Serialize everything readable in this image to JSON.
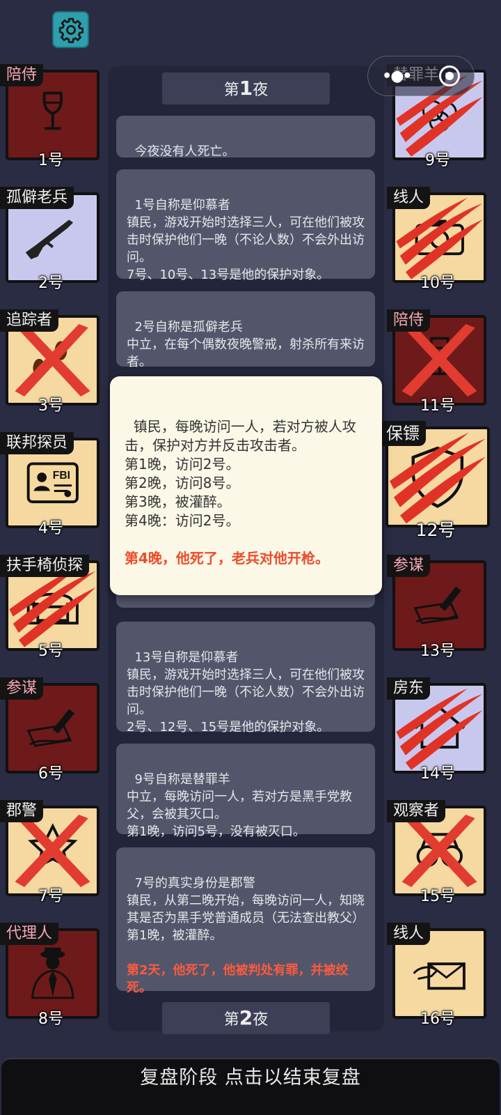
{
  "players_left": [
    {
      "role": "陪侍",
      "number": "1号",
      "bg": "maroon",
      "tag_color": "pink",
      "icon": "wine-glass-icon",
      "mark": "none"
    },
    {
      "role": "孤僻老兵",
      "number": "2号",
      "bg": "lav",
      "tag_color": "white",
      "icon": "rifle-icon",
      "mark": "none"
    },
    {
      "role": "追踪者",
      "number": "3号",
      "bg": "tan",
      "tag_color": "white",
      "icon": "footprints-icon",
      "mark": "cross"
    },
    {
      "role": "联邦探员",
      "number": "4号",
      "bg": "tan",
      "tag_color": "white",
      "icon": "fbi-badge-icon",
      "mark": "none"
    },
    {
      "role": "扶手椅侦探",
      "number": "5号",
      "bg": "tan",
      "tag_color": "white",
      "icon": "armchair-icon",
      "mark": "claw"
    },
    {
      "role": "参谋",
      "number": "6号",
      "bg": "maroon",
      "tag_color": "pink",
      "icon": "pen-paper-icon",
      "mark": "none"
    },
    {
      "role": "郡警",
      "number": "7号",
      "bg": "tan",
      "tag_color": "white",
      "icon": "sheriff-star-icon",
      "mark": "cross"
    },
    {
      "role": "代理人",
      "number": "8号",
      "bg": "maroon",
      "tag_color": "pink",
      "icon": "suited-man-icon",
      "mark": "none"
    }
  ],
  "players_right": [
    {
      "role": "替罪羊",
      "number": "9号",
      "bg": "lav",
      "tag_color": "white",
      "icon": "sheep-icon",
      "mark": "claw"
    },
    {
      "role": "线人",
      "number": "10号",
      "bg": "tan",
      "tag_color": "white",
      "icon": "camera-icon",
      "mark": "claw"
    },
    {
      "role": "陪侍",
      "number": "11号",
      "bg": "maroon",
      "tag_color": "pink",
      "icon": "wine-glass-icon",
      "mark": "cross"
    },
    {
      "role": "保镖",
      "number": "12号",
      "bg": "tan",
      "tag_color": "white",
      "icon": "shield-icon",
      "mark": "claw"
    },
    {
      "role": "参谋",
      "number": "13号",
      "bg": "maroon",
      "tag_color": "pink",
      "icon": "pen-paper-icon",
      "mark": "none"
    },
    {
      "role": "房东",
      "number": "14号",
      "bg": "lav",
      "tag_color": "white",
      "icon": "house-icon",
      "mark": "claw"
    },
    {
      "role": "观察者",
      "number": "15号",
      "bg": "tan",
      "tag_color": "white",
      "icon": "binoculars-icon",
      "mark": "cross"
    },
    {
      "role": "线人",
      "number": "16号",
      "bg": "tan",
      "tag_color": "white",
      "icon": "letter-hand-icon",
      "mark": "none"
    }
  ],
  "log": {
    "night1_prefix": "第",
    "night1_num": "1",
    "night1_suffix": "夜",
    "entries": [
      {
        "text": "今夜没有人死亡。",
        "red": ""
      },
      {
        "text": "1号自称是仰慕者\n镇民，游戏开始时选择三人，可在他们被攻击时保护他们一晚（不论人数）不会外出访问。\n7号、10号、13号是他的保护对象。",
        "red": ""
      },
      {
        "text": "2号自称是孤僻老兵\n中立，在每个偶数夜晚警戒，射杀所有来访者。",
        "red": ""
      },
      {
        "text": "13号自称是仰慕者\n镇民，游戏开始时选择三人，可在他们被攻击时保护他们一晚（不论人数）不会外出访问。\n2号、12号、15号是他的保护对象。",
        "red": ""
      },
      {
        "text": "9号自称是替罪羊\n中立，每晚访问一人，若对方是黑手党教父，会被其灭口。\n第1晚，访问5号，没有被灭口。",
        "red": ""
      },
      {
        "text": "7号的真实身份是郡警\n镇民，从第二晚开始，每晚访问一人，知晓其是否为黑手党普通成员（无法查出教父）\n第1晚，被灌醉。",
        "red": "第2天，他死了，他被判处有罪，并被绞死。"
      }
    ],
    "night2_prefix": "第",
    "night2_num": "2",
    "night2_suffix": "夜"
  },
  "popup": {
    "text": "镇民，每晚访问一人，若对方被人攻击，保护对方并反击攻击者。\n第1晚，访问2号。\n第2晚，访问8号。\n第3晚，被灌醉。\n第4晚：访问2号。",
    "red": "第4晚，他死了，老兵对他开枪。"
  },
  "bottom_bar": "复盘阶段 点击以结束复盘",
  "colors": {
    "background": "#2a2c44",
    "maroon": "#6e1a1a",
    "tan": "#f5d9a0",
    "lavender": "#c8c8ef",
    "red_text": "#ff5a3c",
    "settings": "#2ea0ad"
  }
}
